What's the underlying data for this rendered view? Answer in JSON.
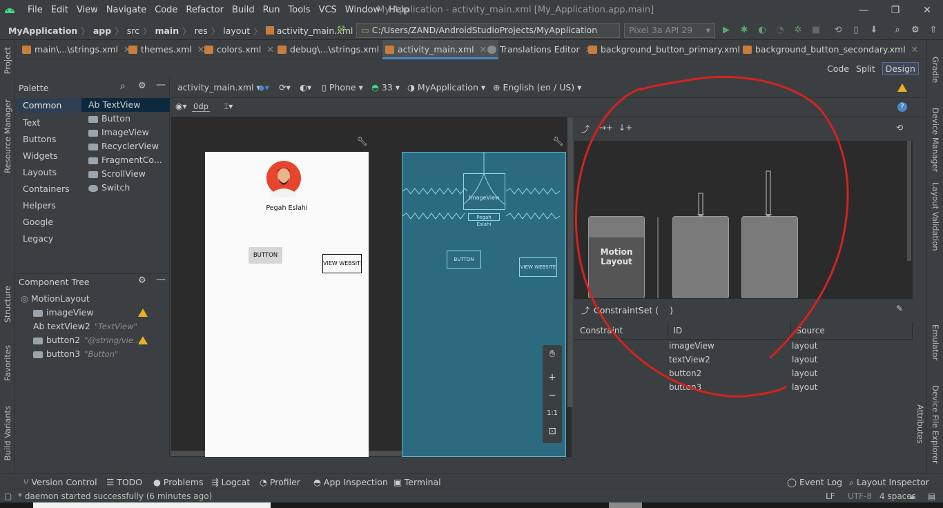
{
  "menubar": {
    "items": [
      "File",
      "Edit",
      "View",
      "Navigate",
      "Code",
      "Refactor",
      "Build",
      "Run",
      "Tools",
      "VCS",
      "Window",
      "Help"
    ],
    "window_title": "My Application - activity_main.xml [My_Application.app.main]"
  },
  "navbar": {
    "crumbs": [
      "MyApplication",
      "app",
      "src",
      "main",
      "res",
      "layout",
      "activity_main.xml"
    ],
    "run_config": "C:/Users/ZAND/AndroidStudioProjects/MyApplication [clean]",
    "device": "Pixel 3a API 29"
  },
  "tabs": [
    {
      "label": "main\\...\\strings.xml",
      "color": "#c87d3d"
    },
    {
      "label": "themes.xml",
      "color": "#c87d3d"
    },
    {
      "label": "colors.xml",
      "color": "#c87d3d"
    },
    {
      "label": "debug\\...\\strings.xml",
      "color": "#c87d3d"
    },
    {
      "label": "activity_main.xml",
      "color": "#c87d3d"
    },
    {
      "label": "Translations Editor",
      "color": "#8a8a8a"
    },
    {
      "label": "background_button_primary.xml",
      "color": "#c87d3d"
    },
    {
      "label": "background_button_secondary.xml",
      "color": "#c87d3d"
    }
  ],
  "view_modes": [
    "Code",
    "Split",
    "Design"
  ],
  "left_strip": [
    "Project",
    "Resource Manager",
    "Structure",
    "Favorites",
    "Build Variants"
  ],
  "right_strip": [
    "Gradle",
    "Device Manager",
    "Layout Validation",
    "Emulator",
    "Device File Explorer"
  ],
  "attributes_label": "Attributes",
  "palette": {
    "title": "Palette",
    "categories": [
      "Common",
      "Text",
      "Buttons",
      "Widgets",
      "Layouts",
      "Containers",
      "Helpers",
      "Google",
      "Legacy"
    ],
    "items": [
      {
        "prefix": "Ab",
        "label": "TextView"
      },
      {
        "prefix": "",
        "label": "Button"
      },
      {
        "prefix": "",
        "label": "ImageView"
      },
      {
        "prefix": "",
        "label": "RecyclerView"
      },
      {
        "prefix": "",
        "label": "FragmentCo..."
      },
      {
        "prefix": "",
        "label": "ScrollView"
      },
      {
        "prefix": "",
        "label": "Switch"
      }
    ]
  },
  "component_tree": {
    "title": "Component Tree",
    "root": "MotionLayout",
    "items": [
      {
        "label": "imageView",
        "sub": "",
        "warn": true
      },
      {
        "label": "textView2",
        "sub": "\"TextView\"",
        "warn": false
      },
      {
        "label": "button2",
        "sub": "\"@string/vie...",
        "warn": true
      },
      {
        "label": "button3",
        "sub": "\"Button\"",
        "warn": false
      }
    ]
  },
  "design_toolbar": {
    "file": "activity_main.xml",
    "device": "Phone",
    "api": "33",
    "theme": "MyApplication",
    "locale": "English (en / US)",
    "margin": "0dp"
  },
  "phone_preview": {
    "name": "Pegah Eslahi",
    "button": "BUTTON",
    "view_website": "VIEW WEBSITE"
  },
  "blueprint": {
    "image": "ImageView",
    "name": "Pegah Eslahi",
    "button": "BUTTON",
    "view_website": "VIEW WEBSITE"
  },
  "zoom": [
    "+",
    "−",
    "1:1"
  ],
  "motion_editor": {
    "motion_layout_label_1": "Motion",
    "motion_layout_label_2": "Layout"
  },
  "constraint_set": {
    "title": "ConstraintSet (    )",
    "headers": [
      "Constraint",
      "ID",
      "Source"
    ],
    "rows": [
      {
        "id": "imageView",
        "source": "layout"
      },
      {
        "id": "textView2",
        "source": "layout"
      },
      {
        "id": "button2",
        "source": "layout"
      },
      {
        "id": "button3",
        "source": "layout"
      }
    ]
  },
  "bottom_tools": [
    "Version Control",
    "TODO",
    "Problems",
    "Logcat",
    "Profiler",
    "App Inspection",
    "Terminal"
  ],
  "bottom_tools_right": [
    "Event Log",
    "Layout Inspector"
  ],
  "status": {
    "message": "* daemon started successfully (6 minutes ago)",
    "line_sep": "LF",
    "encoding": "UTF-8",
    "indent": "4 spaces"
  },
  "colors": {
    "accent": "#4a88c7",
    "annotation": "#d3231f",
    "warning": "#e8b028"
  }
}
